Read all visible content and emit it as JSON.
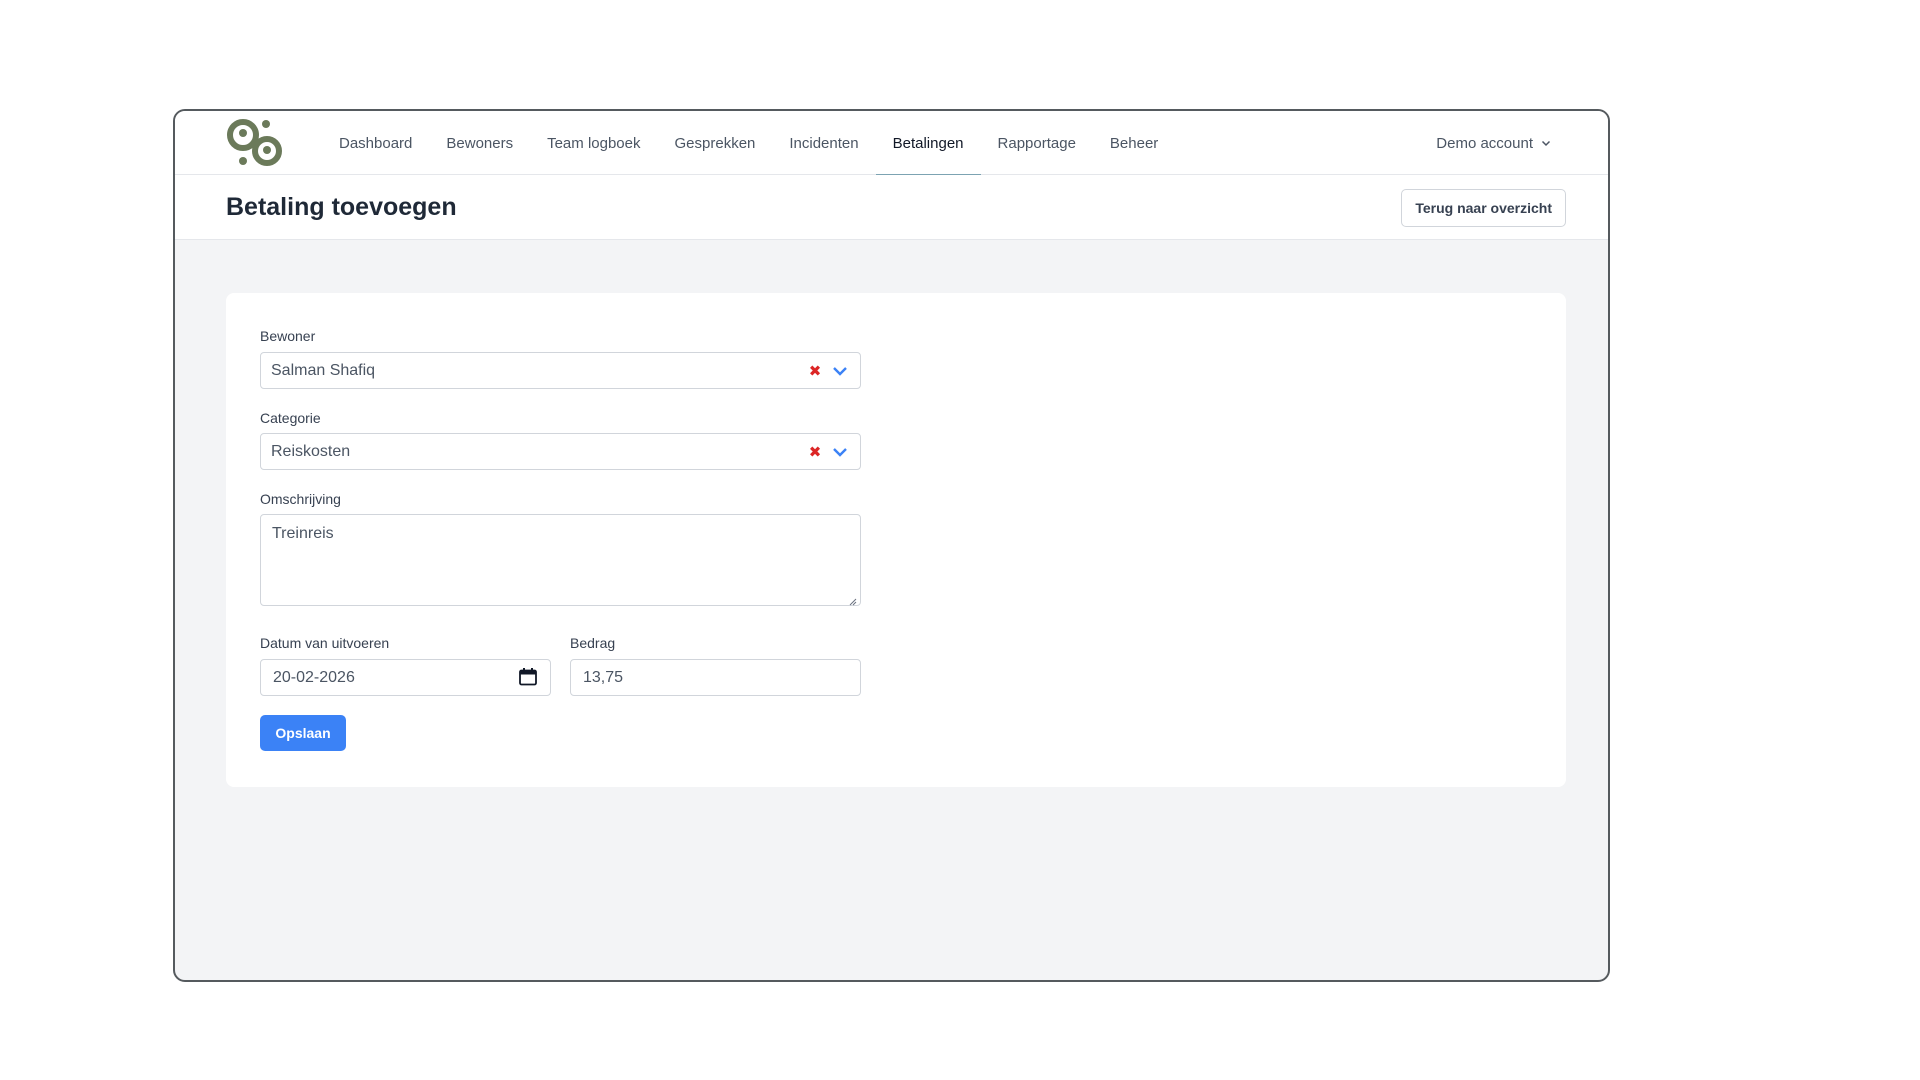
{
  "nav": {
    "items": [
      {
        "label": "Dashboard"
      },
      {
        "label": "Bewoners"
      },
      {
        "label": "Team logboek"
      },
      {
        "label": "Gesprekken"
      },
      {
        "label": "Incidenten"
      },
      {
        "label": "Betalingen",
        "active": true
      },
      {
        "label": "Rapportage"
      },
      {
        "label": "Beheer"
      }
    ],
    "account_label": "Demo account"
  },
  "header": {
    "title": "Betaling toevoegen",
    "back_label": "Terug naar overzicht"
  },
  "form": {
    "bewoner": {
      "label": "Bewoner",
      "value": "Salman Shafiq"
    },
    "categorie": {
      "label": "Categorie",
      "value": "Reiskosten"
    },
    "omschrijving": {
      "label": "Omschrijving",
      "value": "Treinreis"
    },
    "datum": {
      "label": "Datum van uitvoeren",
      "value": "20-02-2026"
    },
    "bedrag": {
      "label": "Bedrag",
      "value": "13,75"
    },
    "save_label": "Opslaan"
  },
  "colors": {
    "primary": "#3b82f6",
    "logo": "#6b7a5a",
    "active_underline": "#7ca3b2",
    "clear": "#dc2626"
  }
}
